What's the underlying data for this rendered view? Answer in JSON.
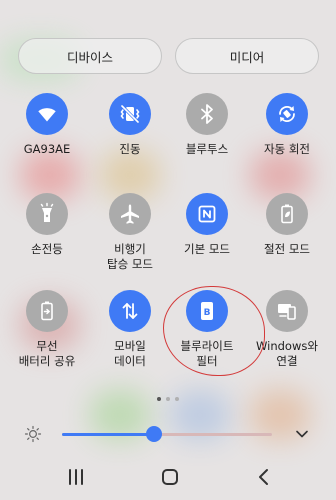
{
  "media_tabs": {
    "devices": "디바이스",
    "media": "미디어"
  },
  "tiles": [
    {
      "label": "GA93AE",
      "icon": "wifi-icon",
      "state": "on"
    },
    {
      "label": "진동",
      "icon": "vibrate-icon",
      "state": "on"
    },
    {
      "label": "블루투스",
      "icon": "bluetooth-icon",
      "state": "off"
    },
    {
      "label": "자동 회전",
      "icon": "auto-rotate-icon",
      "state": "on"
    },
    {
      "label": "손전등",
      "icon": "flashlight-icon",
      "state": "off"
    },
    {
      "label": "비행기\n탑승 모드",
      "icon": "airplane-icon",
      "state": "off"
    },
    {
      "label": "기본 모드",
      "icon": "nfc-icon",
      "state": "on"
    },
    {
      "label": "절전 모드",
      "icon": "battery-saver-icon",
      "state": "off"
    },
    {
      "label": "무선\n배터리 공유",
      "icon": "wireless-battery-share-icon",
      "state": "off"
    },
    {
      "label": "모바일\n데이터",
      "icon": "mobile-data-icon",
      "state": "on"
    },
    {
      "label": "블루라이트\n필터",
      "icon": "blue-light-filter-icon",
      "state": "on"
    },
    {
      "label": "Windows와\n연결",
      "icon": "link-to-windows-icon",
      "state": "off"
    }
  ],
  "page_indicator": {
    "count": 3,
    "active": 0
  },
  "brightness": {
    "level": 0.44
  },
  "colors": {
    "accent": "#3f7af5",
    "inactive": "#ababab",
    "annotation": "#d33a3a"
  }
}
